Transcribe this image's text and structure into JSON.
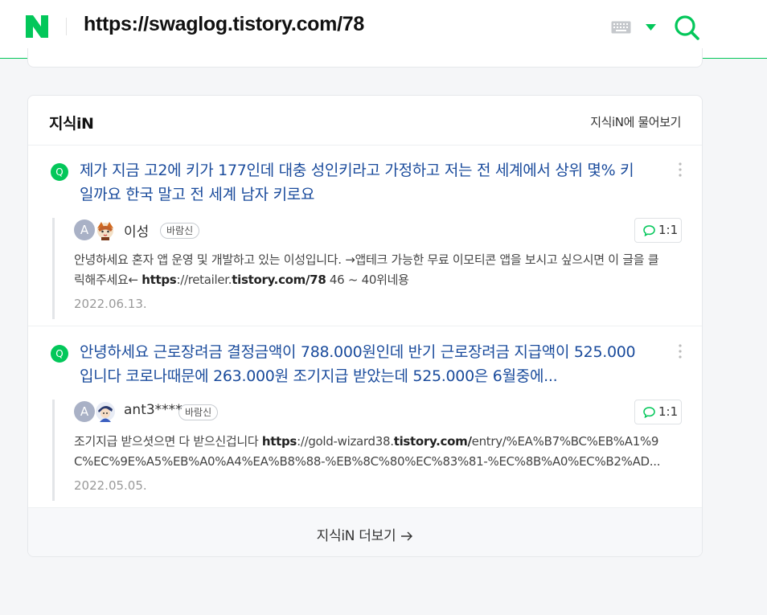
{
  "search": {
    "query": "https://swaglog.tistory.com/78"
  },
  "colors": {
    "brand_green": "#03c75a",
    "link_blue": "#1a4b9c"
  },
  "kin": {
    "title": "지식iN",
    "ask_link": "지식iN에 물어보기",
    "more_link": "지식iN 더보기",
    "items": [
      {
        "badge": "Q",
        "title": "제가 지금 고2에 키가 177인데 대충 성인키라고 가정하고 저는 전 세계에서 상위 몇% 키일까요 한국 말고 전 세계 남자 키로요",
        "answer": {
          "avatar_letter": "A",
          "name": "이성",
          "tag": "바람신",
          "chat_label": "1:1",
          "text_pre": "안녕하세요 혼자 앱 운영 및 개발하고 있는 이성입니다. →앱테크 가능한 무료 이모티콘 앱을 보시고 싶으시면 이 글을 클릭해주세요← ",
          "text_b1": "https",
          "text_m1": "://retailer.",
          "text_b2": "tistory.com/78",
          "text_post": " 46 ~ 40위네용",
          "date": "2022.06.13."
        }
      },
      {
        "badge": "Q",
        "title": "안녕하세요 근로장려금 결정금액이 788.000원인데 반기 근로장려금 지급액이 525.000 입니다 코로나때문에 263.000원 조기지급 받았는데 525.000은 6월중에...",
        "answer": {
          "avatar_letter": "A",
          "name": "ant3****",
          "tag": "바람신",
          "chat_label": "1:1",
          "text_pre": "조기지급 받으셧으면 다 받으신겁니다 ",
          "text_b1": "https",
          "text_m1": "://gold-wizard38.",
          "text_b2": "tistory.com/",
          "text_post": "entry/%EA%B7%BC%EB%A1%9C%EC%9E%A5%EB%A0%A4%EA%B8%88-%EB%8C%80%EC%83%81-%EC%8B%A0%EC%B2%AD...",
          "date": "2022.05.05."
        }
      }
    ]
  }
}
